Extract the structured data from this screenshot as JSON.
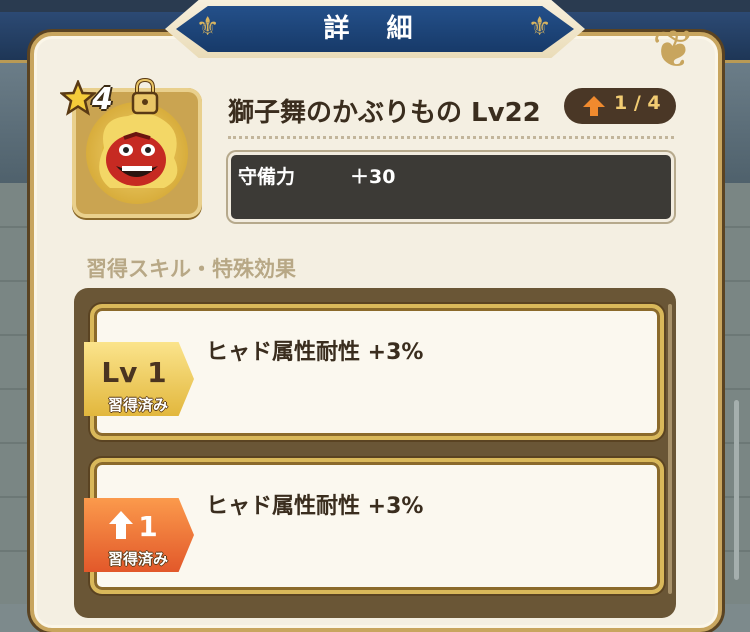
{
  "header": {
    "title": "詳 細"
  },
  "item": {
    "rarity": "4",
    "name": "獅子舞のかぶりもの Lv22",
    "upgrade": "1 / 4"
  },
  "stats": {
    "label": "守備力",
    "value": "＋30"
  },
  "skills_section": {
    "title": "習得スキル・特殊効果"
  },
  "skills": [
    {
      "level": "Lv 1",
      "status": "習得済み",
      "name": "ヒャド属性耐性 +3%",
      "tag_color": "gold"
    },
    {
      "level": "1",
      "status": "習得済み",
      "name": "ヒャド属性耐性 +3%",
      "tag_color": "orange"
    }
  ],
  "colors": {
    "title_blue": "#1e4a82",
    "gold": "#d9b85a",
    "panel": "#f4efe2",
    "stat_box": "#3c3a36",
    "upgrade_text": "#f2cc73",
    "orange_tag": "#ee6a30"
  },
  "icons": [
    "star-icon",
    "lock-icon",
    "lion-mask-icon",
    "up-arrow-icon",
    "fleur-icon"
  ]
}
